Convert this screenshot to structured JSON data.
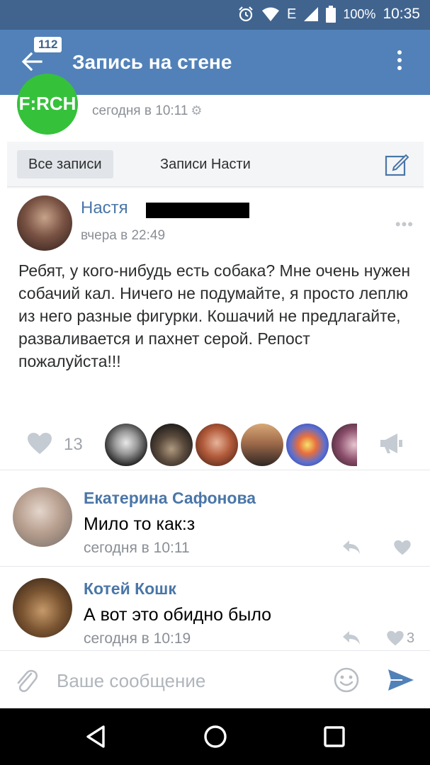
{
  "status_bar": {
    "network": "E",
    "battery": "100%",
    "time": "10:35",
    "icons": [
      "alarm-icon",
      "wifi-icon",
      "signal-icon",
      "battery-icon"
    ]
  },
  "app_bar": {
    "badge": "112",
    "title": "Запись на стене"
  },
  "post": {
    "group_logo_text": "F:RCH",
    "time": "сегодня в 10:11"
  },
  "screenshot": {
    "tab_all": "Все записи",
    "tab_author": "Записи Насти",
    "author_name": "Настя",
    "author_time": "вчера в 22:49",
    "more": "•••",
    "text": "Ребят, у кого-нибудь есть собака? Мне очень нужен собачий кал. Ничего не подумайте, я просто леплю из него разные фигурки. Кошачий не предлагайте, разваливается и пахнет серой. Репост пожалуйста!!!"
  },
  "likes": {
    "count": "13"
  },
  "comments": [
    {
      "name": "Екатерина Сафонова",
      "text": "Мило то как:з",
      "time": "сегодня в 10:11",
      "likes": ""
    },
    {
      "name": "Котей Кошк",
      "text": "А вот это обидно было",
      "time": "сегодня в 10:19",
      "likes": "3"
    }
  ],
  "composer": {
    "placeholder": "Ваше сообщение"
  },
  "colors": {
    "status_bar": "#41648f",
    "app_bar": "#5181b8",
    "link": "#4a76a8",
    "group_logo": "#36c13b"
  }
}
